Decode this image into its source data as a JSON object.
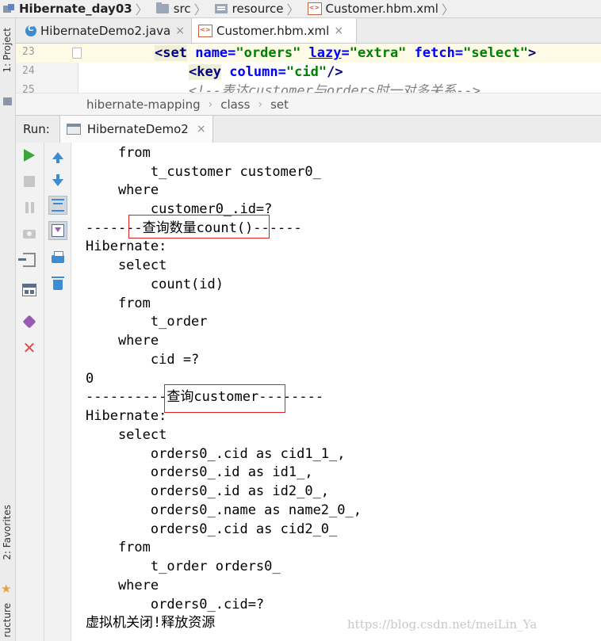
{
  "navbar": {
    "crumbs": [
      {
        "label": "Hibernate_day03"
      },
      {
        "label": "src"
      },
      {
        "label": "resource"
      },
      {
        "label": "Customer.hbm.xml"
      }
    ],
    "separator": "〉"
  },
  "left_strip": {
    "project_label": "1: Project",
    "favorites_label": "2: Favorites",
    "structure_label": "ructure"
  },
  "tabs": [
    {
      "label": "HibernateDemo2.java",
      "close": "×",
      "active": false
    },
    {
      "label": "Customer.hbm.xml",
      "close": "×",
      "active": true
    }
  ],
  "editor": {
    "lines": [
      {
        "num": "23"
      },
      {
        "num": "24"
      },
      {
        "num": "25"
      }
    ],
    "line23": {
      "open": "<",
      "tag": "set",
      "a1": "name",
      "eq": "=",
      "v1": "\"orders\"",
      "a2": "lazy",
      "v2": "\"extra\"",
      "a3": "fetch",
      "v3": "\"select\"",
      "close": ">"
    },
    "line24": {
      "open": "<",
      "tag": "key",
      "a1": "column",
      "eq": "=",
      "v1": "\"cid\"",
      "close": "/>"
    },
    "line25": {
      "comment": "<!--表达customer与orders时一对多关系-->"
    }
  },
  "xml_breadcrumb": {
    "items": [
      "hibernate-mapping",
      "class",
      "set"
    ],
    "separator": "›"
  },
  "run": {
    "label": "Run:",
    "tab_label": "HibernateDemo2",
    "tab_close": "×"
  },
  "console": {
    "lines": [
      "    from",
      "        t_customer customer0_",
      "    where",
      "        customer0_.id=?",
      "-------查询数量count()------",
      "Hibernate:",
      "    select",
      "        count(id)",
      "    from",
      "        t_order",
      "    where",
      "        cid =?",
      "0",
      "----------查询customer--------",
      "Hibernate:",
      "    select",
      "        orders0_.cid as cid1_1_,",
      "        orders0_.id as id1_,",
      "        orders0_.id as id2_0_,",
      "        orders0_.name as name2_0_,",
      "        orders0_.cid as cid2_0_",
      "    from",
      "        t_order orders0_",
      "    where",
      "        orders0_.cid=?",
      "虚拟机关闭!释放资源"
    ]
  },
  "watermark": "https://blog.csdn.net/meiLin_Ya",
  "colors": {
    "accent": "#3d8bd0",
    "highlight_box": "#e02020",
    "run_green": "#3aa63a"
  }
}
